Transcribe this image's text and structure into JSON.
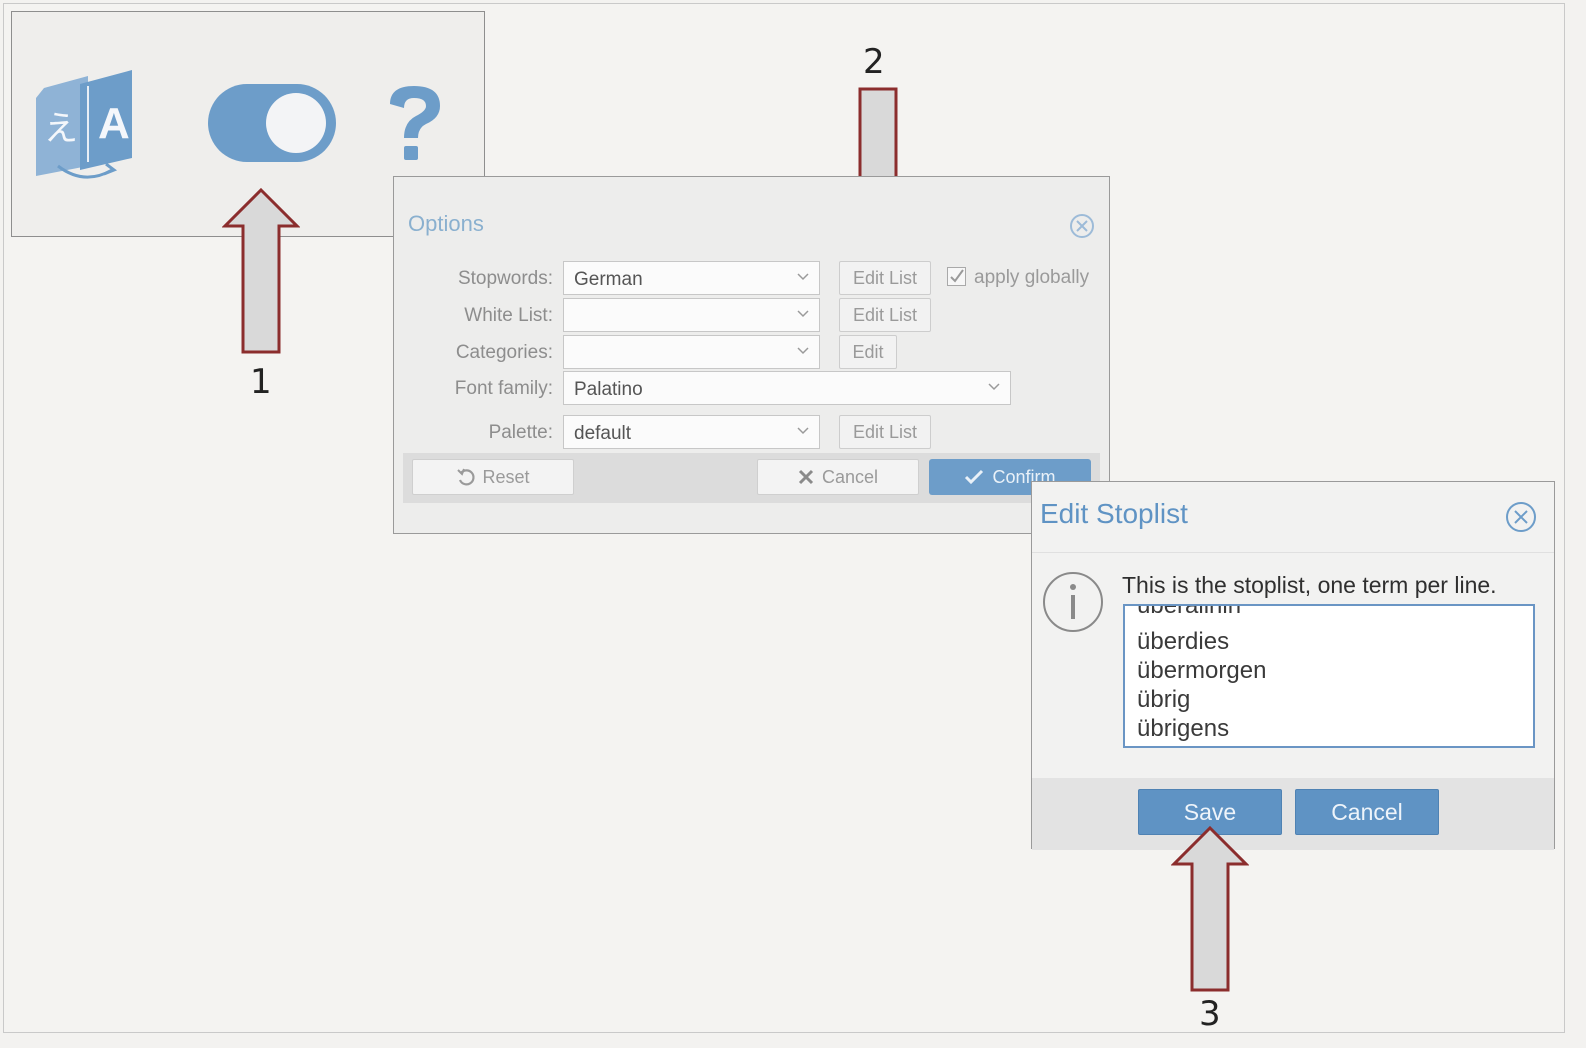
{
  "toolbar": {
    "icons": [
      "translate-icon",
      "toggle-icon",
      "help-icon"
    ]
  },
  "steps": [
    "1",
    "2",
    "3"
  ],
  "options_dialog": {
    "title": "Options",
    "rows": {
      "stopwords": {
        "label": "Stopwords:",
        "value": "German",
        "button": "Edit List"
      },
      "whitelist": {
        "label": "White List:",
        "value": "",
        "button": "Edit List"
      },
      "categories": {
        "label": "Categories:",
        "value": "",
        "button": "Edit"
      },
      "font_family": {
        "label": "Font family:",
        "value": "Palatino"
      },
      "palette": {
        "label": "Palette:",
        "value": "default",
        "button": "Edit List"
      }
    },
    "apply_globally": {
      "label": "apply globally",
      "checked": true
    },
    "footer": {
      "reset": "Reset",
      "cancel": "Cancel",
      "confirm": "Confirm"
    }
  },
  "stoplist_dialog": {
    "title": "Edit Stoplist",
    "description": "This is the stoplist, one term per line.",
    "terms": [
      "überallhin",
      "überdies",
      "übermorgen",
      "übrig",
      "übrigens"
    ],
    "save": "Save",
    "cancel": "Cancel"
  },
  "colors": {
    "accent": "#5f93c4",
    "arrow_fill": "#d9d9d9",
    "arrow_stroke": "#8b2d2d",
    "icon_blue": "#6d9dc9"
  }
}
